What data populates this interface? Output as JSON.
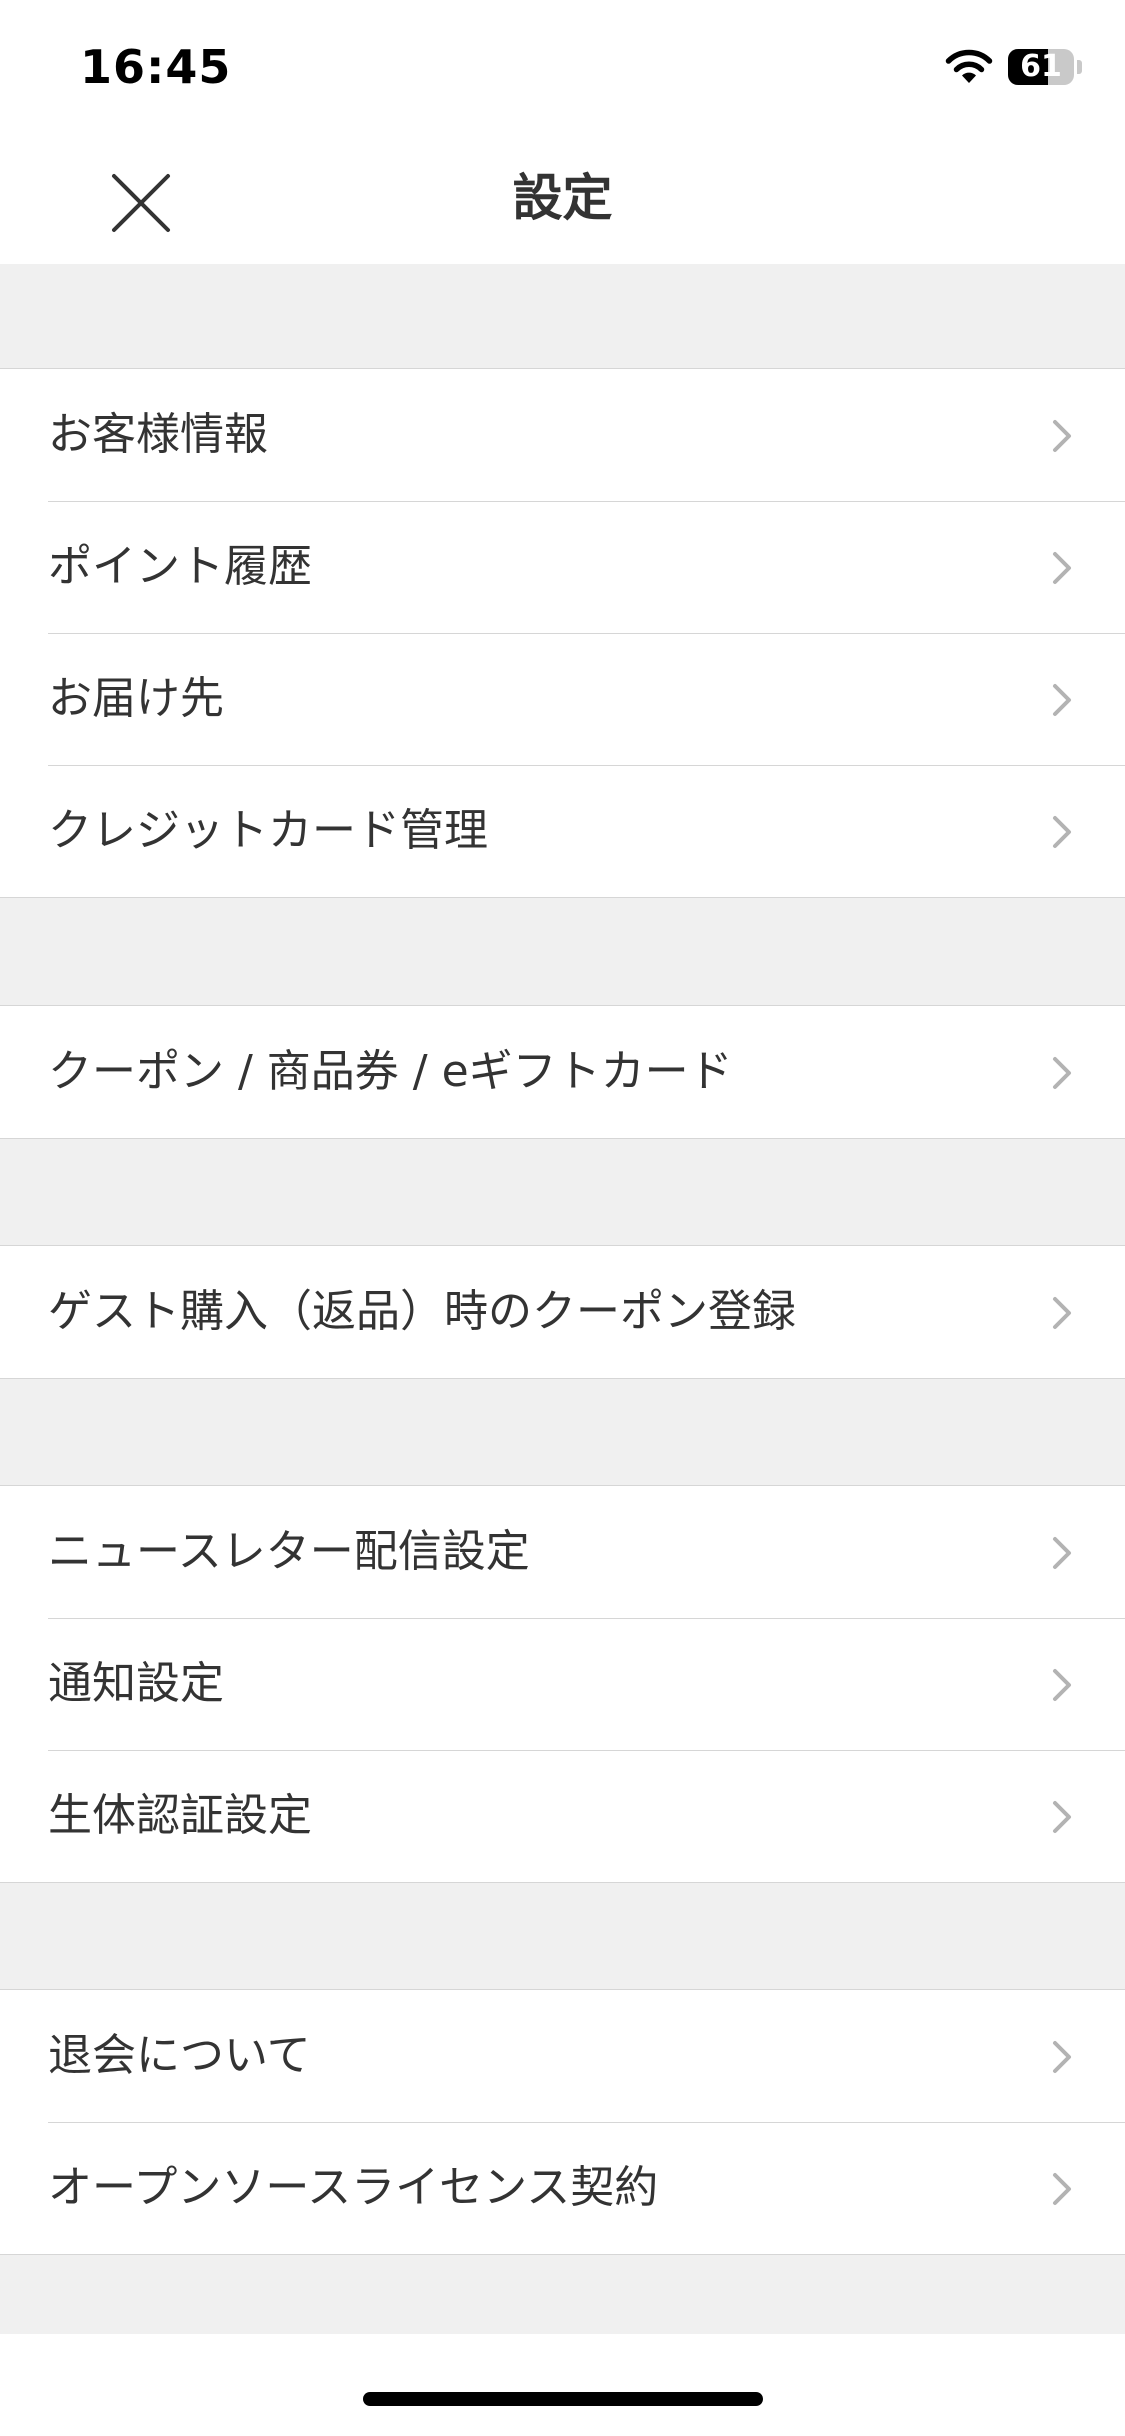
{
  "status_bar": {
    "time": "16:45",
    "battery_level": "61",
    "battery_fraction": 0.61,
    "icons": [
      "wifi-icon",
      "battery-icon"
    ]
  },
  "nav": {
    "title": "設定",
    "close_icon": "close-icon"
  },
  "sections": [
    {
      "items": [
        {
          "label": "お客様情報"
        },
        {
          "label": "ポイント履歴"
        },
        {
          "label": "お届け先"
        },
        {
          "label": "クレジットカード管理"
        }
      ]
    },
    {
      "items": [
        {
          "label": "クーポン / 商品券 / eギフトカード"
        }
      ]
    },
    {
      "items": [
        {
          "label": "ゲスト購入（返品）時のクーポン登録"
        }
      ]
    },
    {
      "items": [
        {
          "label": "ニュースレター配信設定"
        },
        {
          "label": "通知設定"
        },
        {
          "label": "生体認証設定"
        }
      ]
    },
    {
      "items": [
        {
          "label": "退会について"
        },
        {
          "label": "オープンソースライセンス契約"
        }
      ]
    }
  ],
  "colors": {
    "background": "#f0f0f0",
    "surface": "#ffffff",
    "text": "#333333",
    "divider": "#d6d6d6",
    "chevron": "#b3b3b3"
  }
}
